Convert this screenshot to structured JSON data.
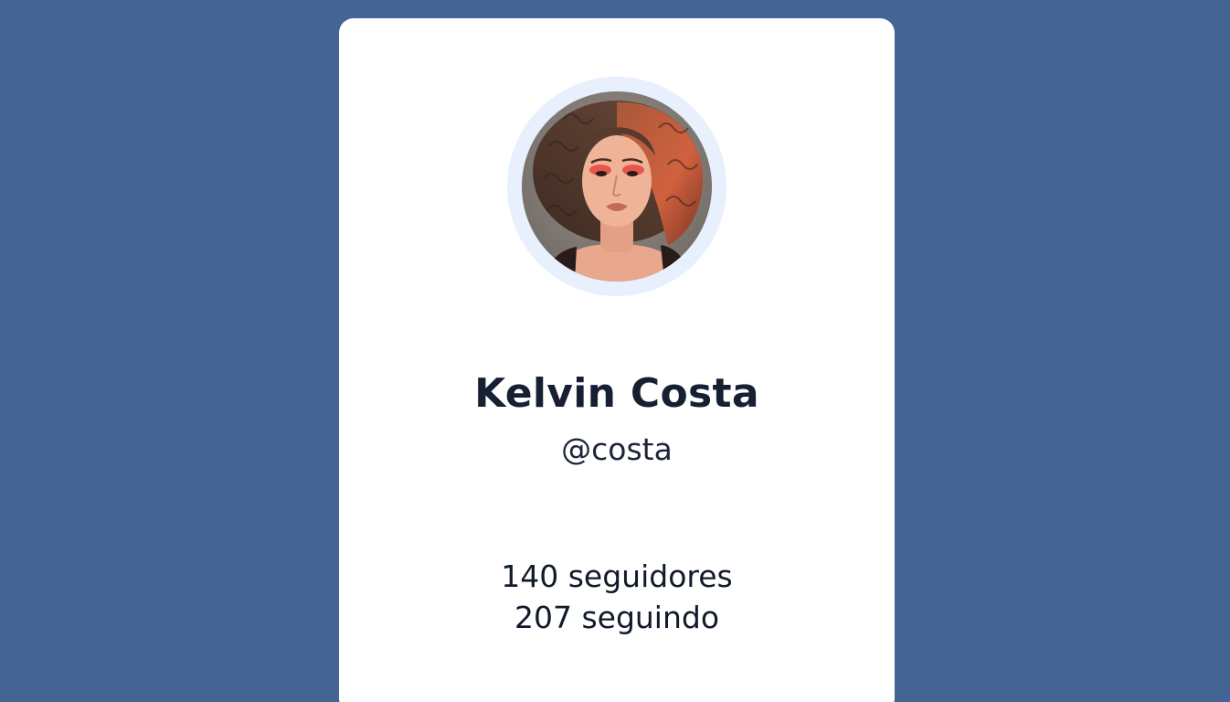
{
  "colors": {
    "background": "#446493",
    "card": "#ffffff",
    "avatar_ring": "#e8f0fd",
    "text_primary": "#172033"
  },
  "profile": {
    "avatar_icon": "profile-photo",
    "name": "Kelvin Costa",
    "handle": "@costa",
    "followers": "140 seguidores",
    "following": "207 seguindo"
  }
}
